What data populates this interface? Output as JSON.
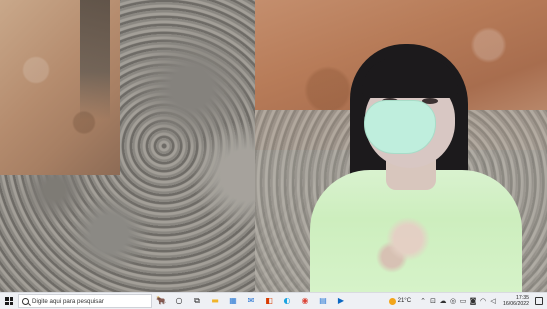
{
  "taskbar": {
    "search_placeholder": "Digite aqui para pesquisar",
    "pinned_apps": [
      {
        "icon": "windows-ink-logo-icon",
        "glyph": "🐂",
        "color": "#5b6bd6"
      },
      {
        "icon": "cortana-icon",
        "glyph": "○",
        "color": "#222222"
      },
      {
        "icon": "task-view-icon",
        "glyph": "⧉",
        "color": "#222222"
      },
      {
        "icon": "file-explorer-icon",
        "glyph": "▬",
        "color": "#f0b429"
      },
      {
        "icon": "store-icon",
        "glyph": "▦",
        "color": "#2a7ad5"
      },
      {
        "icon": "mail-icon",
        "glyph": "✉",
        "color": "#1f6fd1"
      },
      {
        "icon": "office-icon",
        "glyph": "◧",
        "color": "#d83b01"
      },
      {
        "icon": "edge-icon",
        "glyph": "◐",
        "color": "#1aa3e0"
      },
      {
        "icon": "chrome-icon",
        "glyph": "◉",
        "color": "#db4437"
      },
      {
        "icon": "calculator-icon",
        "glyph": "▤",
        "color": "#2a7ad5"
      },
      {
        "icon": "media-player-icon",
        "glyph": "▶",
        "color": "#0b67c2"
      }
    ]
  },
  "tray": {
    "temperature": "21°C",
    "time": "17:35",
    "date": "16/06/2022",
    "icons": [
      "chevron-up-icon",
      "network-icon",
      "onedrive-icon",
      "location-icon",
      "battery-icon",
      "camera-icon",
      "wifi-icon",
      "volume-icon"
    ]
  },
  "colors": {
    "taskbar_bg": "#eef0f4",
    "weather_sun": "#f2a51a"
  }
}
